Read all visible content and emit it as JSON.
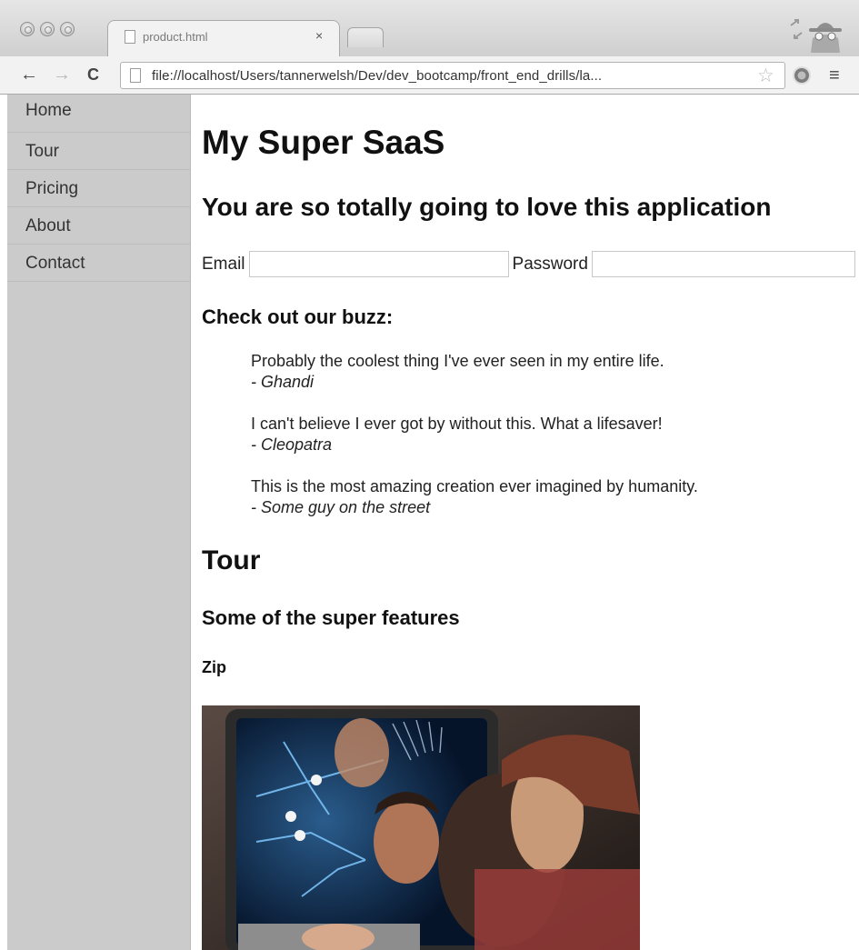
{
  "browser": {
    "tab_title": "product.html",
    "tab_close": "×",
    "url": "file://localhost/Users/tannerwelsh/Dev/dev_bootcamp/front_end_drills/la...",
    "back_glyph": "←",
    "forward_glyph": "→",
    "reload_glyph": "C",
    "star_glyph": "☆",
    "menu_glyph": "≡",
    "icons": [
      "page-icon",
      "star-icon",
      "incognito-icon",
      "extension-icon",
      "menu-icon"
    ]
  },
  "sidebar": {
    "items": [
      {
        "label": "Home"
      },
      {
        "label": "Tour"
      },
      {
        "label": "Pricing"
      },
      {
        "label": "About"
      },
      {
        "label": "Contact"
      }
    ]
  },
  "main": {
    "title": "My Super SaaS",
    "tagline": "You are so totally going to love this application",
    "login": {
      "email_label": "Email",
      "email_value": "",
      "password_label": "Password",
      "password_value": ""
    },
    "buzz_heading": "Check out our buzz:",
    "quotes": [
      {
        "text": "Probably the coolest thing I've ever seen in my entire life.",
        "author": "- Ghandi"
      },
      {
        "text": "I can't believe I ever got by without this. What a lifesaver!",
        "author": "- Cleopatra"
      },
      {
        "text": "This is the most amazing creation ever imagined by humanity.",
        "author": "- Some guy on the street"
      }
    ],
    "tour_heading": "Tour",
    "features_heading": "Some of the super features",
    "feature_name": "Zip"
  },
  "colors": {
    "sidebar_bg": "#cbcbcb",
    "page_bg": "#ffffff",
    "chrome_bg": "#e6e6e6"
  }
}
